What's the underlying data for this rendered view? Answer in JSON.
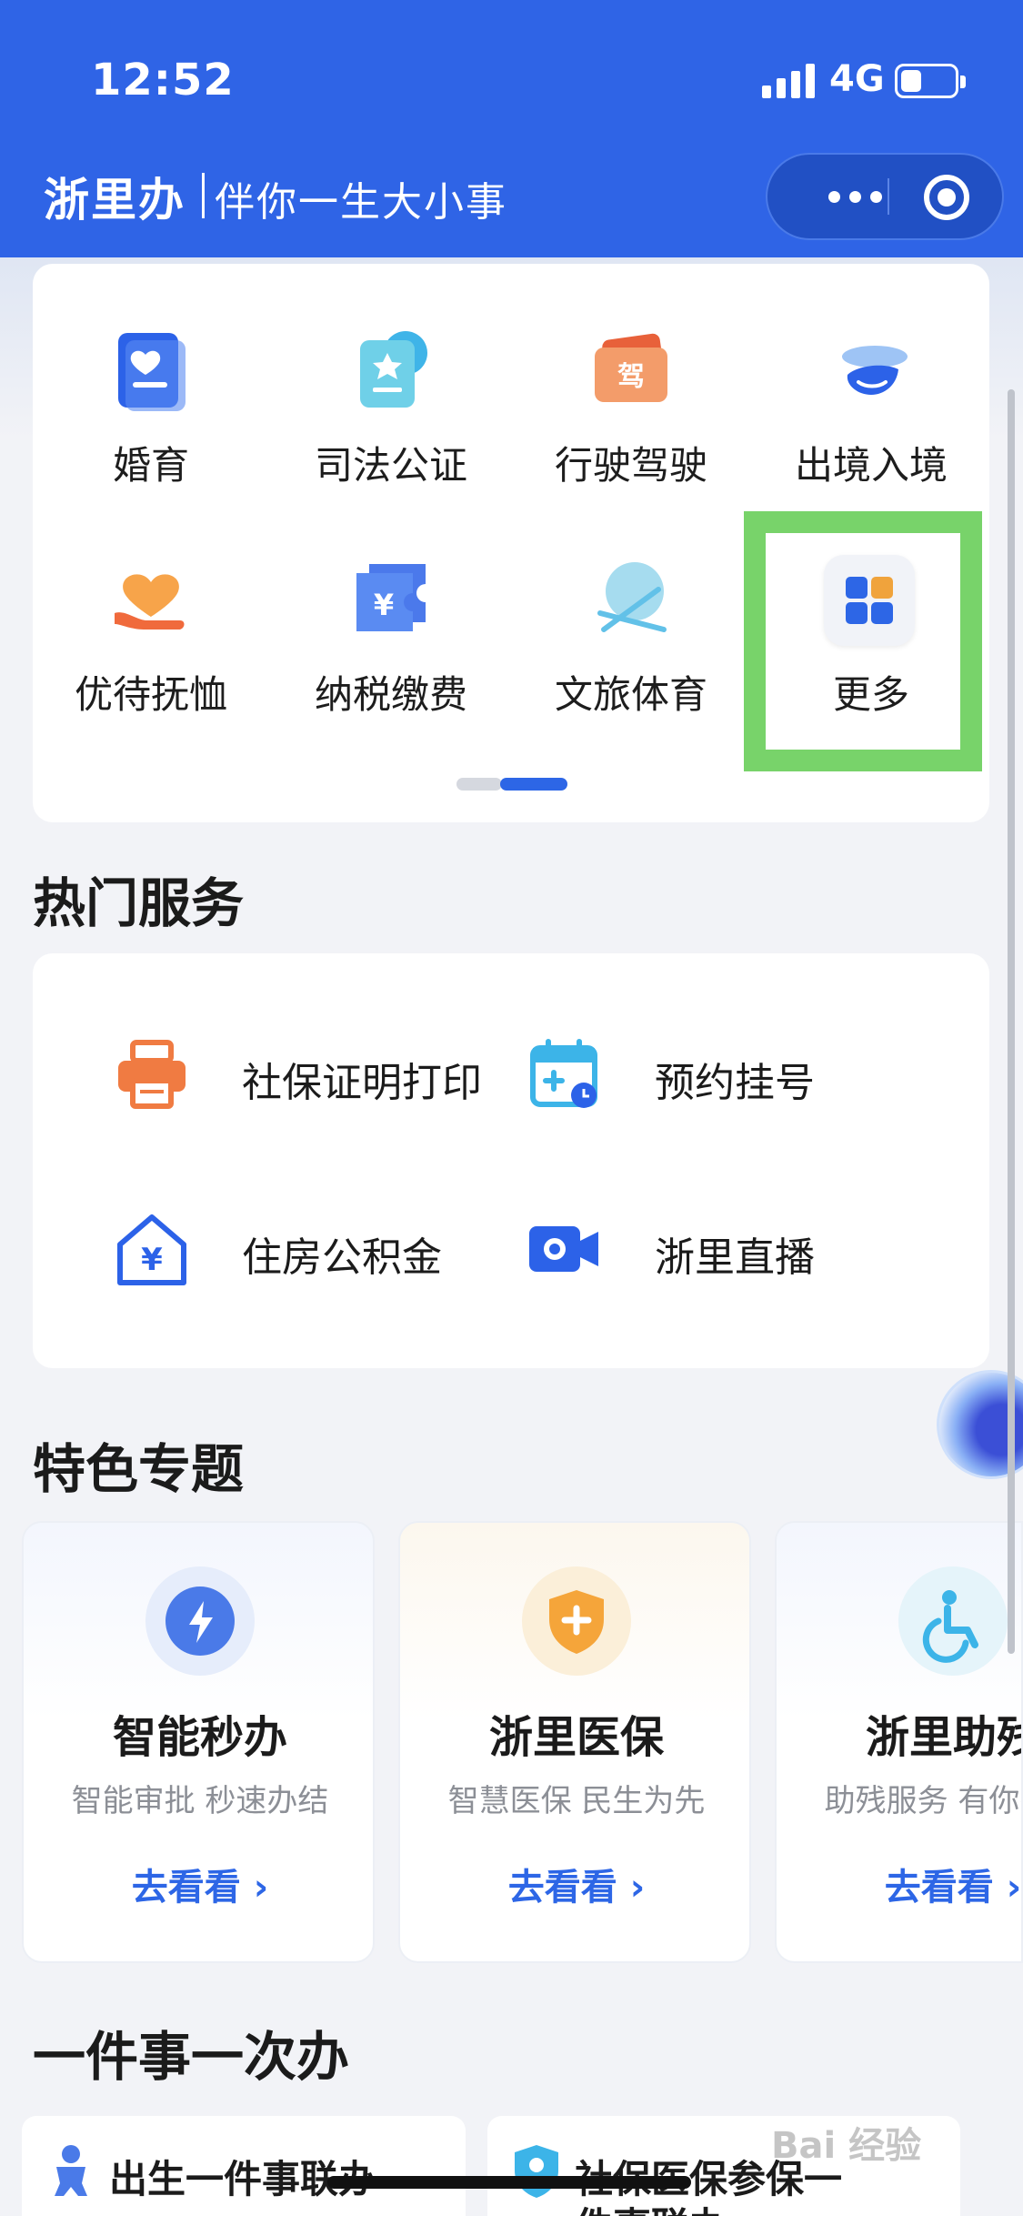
{
  "status_bar": {
    "time": "12:52",
    "network": "4G",
    "battery_level": 0.4
  },
  "header": {
    "brand": "浙里办",
    "slogan": "伴你一生大小事",
    "icons": [
      "more-dots-icon",
      "target-icon"
    ]
  },
  "categories": [
    {
      "label": "婚育",
      "icon": "marriage-icon"
    },
    {
      "label": "司法公证",
      "icon": "notary-icon"
    },
    {
      "label": "行驶驾驶",
      "icon": "driving-icon"
    },
    {
      "label": "出境入境",
      "icon": "airplane-icon"
    },
    {
      "label": "优待抚恤",
      "icon": "heart-hand-icon"
    },
    {
      "label": "纳税缴费",
      "icon": "tax-ticket-icon"
    },
    {
      "label": "文旅体育",
      "icon": "ball-icon"
    },
    {
      "label": "更多",
      "icon": "grid-icon"
    }
  ],
  "pager": {
    "pages": 2,
    "current": 2
  },
  "hot_services": {
    "title": "热门服务",
    "items": [
      {
        "label": "社保证明打印",
        "icon": "printer-icon"
      },
      {
        "label": "预约挂号",
        "icon": "calendar-icon"
      },
      {
        "label": "住房公积金",
        "icon": "house-yuan-icon"
      },
      {
        "label": "浙里直播",
        "icon": "video-camera-icon"
      }
    ]
  },
  "features": {
    "title": "特色专题",
    "items": [
      {
        "title": "智能秒办",
        "sub": "智能审批 秒速办结",
        "go": "去看看 ›",
        "icon": "lightning-icon"
      },
      {
        "title": "浙里医保",
        "sub": "智慧医保 民生为先",
        "go": "去看看 ›",
        "icon": "medical-shield-icon"
      },
      {
        "title": "浙里助残",
        "sub": "助残服务 有你有我",
        "go": "去看看 ›",
        "icon": "wheelchair-icon"
      }
    ]
  },
  "one_thing": {
    "title": "一件事一次办",
    "items": [
      {
        "line1": "出生一件事联办",
        "line2": "",
        "icon": "baby-icon"
      },
      {
        "line1": "社保医保参保一",
        "line2": "件事联办",
        "icon": "person-shield-icon"
      }
    ]
  },
  "watermark": "Bai 经验",
  "colors": {
    "primary": "#2f64e6",
    "highlight": "#78d36a",
    "page_bg": "#f2f3f7"
  }
}
